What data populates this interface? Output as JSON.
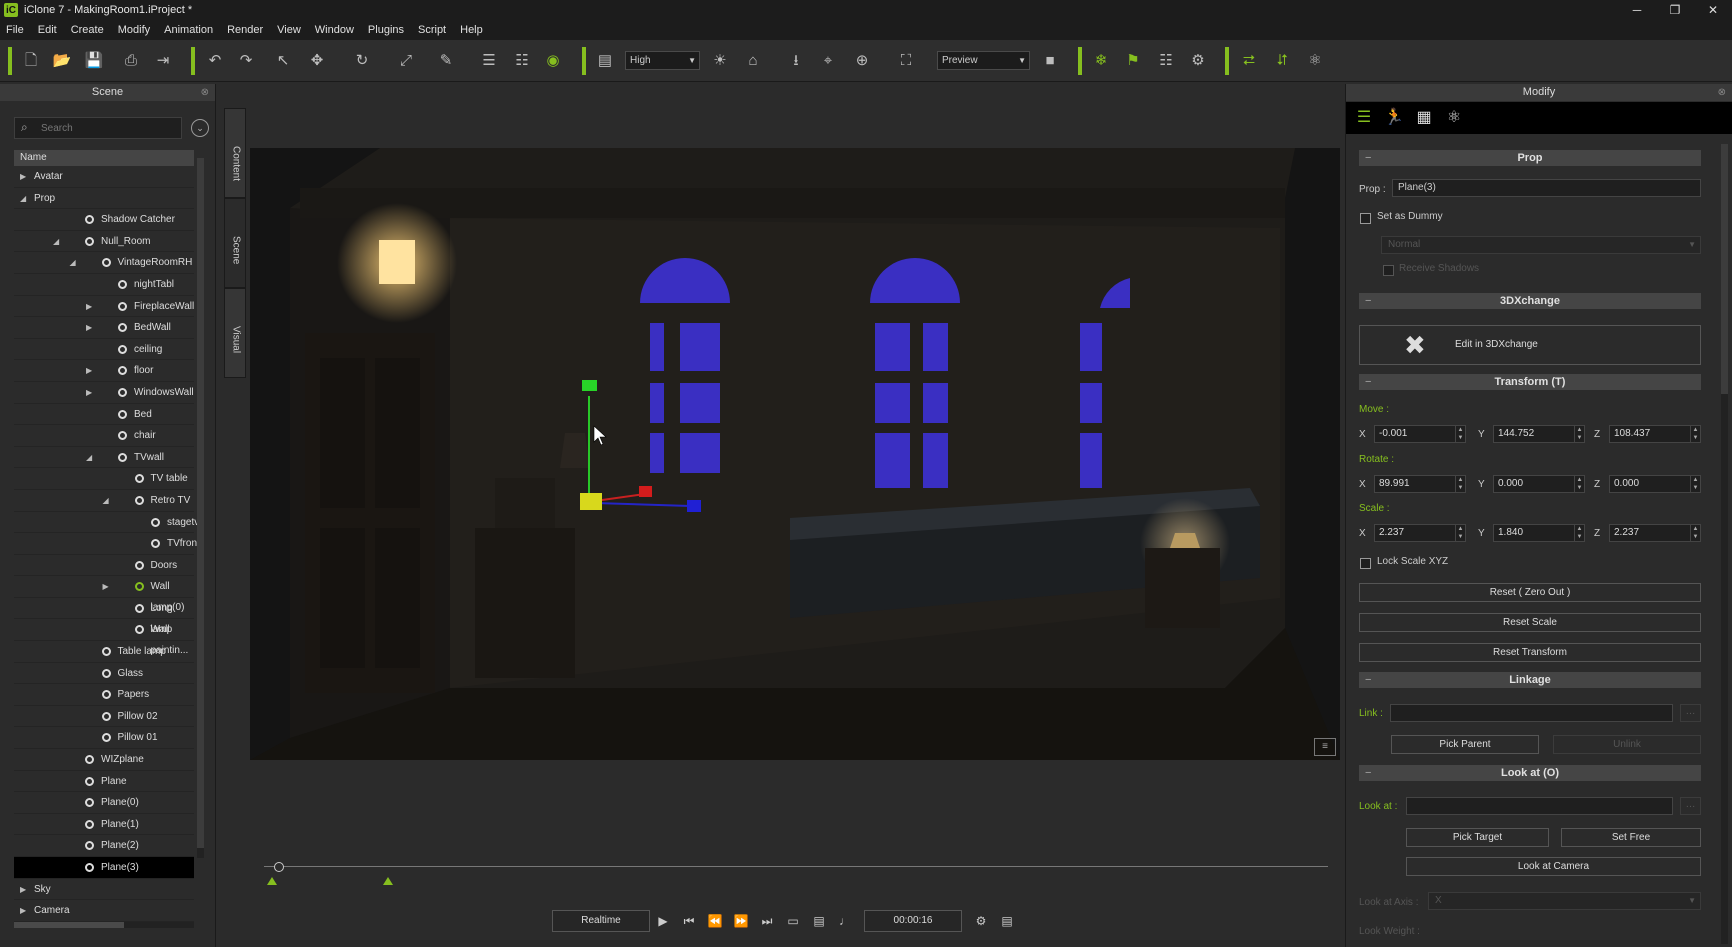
{
  "window": {
    "title": "iClone 7 - MakingRoom1.iProject *",
    "logo": "iC",
    "controls": [
      "minimize-icon",
      "restore-icon",
      "close-icon"
    ]
  },
  "menu": [
    "File",
    "Edit",
    "Create",
    "Modify",
    "Animation",
    "Render",
    "View",
    "Window",
    "Plugins",
    "Script",
    "Help"
  ],
  "toolbar": {
    "quality_value": "High",
    "render_mode_value": "Preview",
    "accent": "#86bf1f"
  },
  "scene_panel": {
    "title": "Scene",
    "search_placeholder": "Search",
    "column_name": "Name",
    "items": [
      {
        "label": "Avatar",
        "depth": 0,
        "expand": "collapsed",
        "icon": false
      },
      {
        "label": "Prop",
        "depth": 0,
        "expand": "expanded",
        "icon": false
      },
      {
        "label": "Shadow Catcher",
        "depth": 2,
        "expand": "none",
        "icon": true
      },
      {
        "label": "Null_Room",
        "depth": 2,
        "expand": "expanded",
        "icon": true
      },
      {
        "label": "VintageRoomRH",
        "depth": 3,
        "expand": "expanded",
        "icon": true
      },
      {
        "label": "nightTabl",
        "depth": 4,
        "expand": "none",
        "icon": true
      },
      {
        "label": "FireplaceWall",
        "depth": 4,
        "expand": "collapsed",
        "icon": true
      },
      {
        "label": "BedWall",
        "depth": 4,
        "expand": "collapsed",
        "icon": true
      },
      {
        "label": "ceiling",
        "depth": 4,
        "expand": "none",
        "icon": true
      },
      {
        "label": "floor",
        "depth": 4,
        "expand": "collapsed",
        "icon": true
      },
      {
        "label": "WindowsWall",
        "depth": 4,
        "expand": "collapsed",
        "icon": true
      },
      {
        "label": "Bed",
        "depth": 4,
        "expand": "none",
        "icon": true
      },
      {
        "label": "chair",
        "depth": 4,
        "expand": "none",
        "icon": true
      },
      {
        "label": "TVwall",
        "depth": 4,
        "expand": "expanded",
        "icon": true
      },
      {
        "label": "TV table",
        "depth": 5,
        "expand": "none",
        "icon": true
      },
      {
        "label": "Retro TV",
        "depth": 5,
        "expand": "expanded",
        "icon": true
      },
      {
        "label": "stagetv",
        "depth": 6,
        "expand": "none",
        "icon": true
      },
      {
        "label": "TVfront",
        "depth": 6,
        "expand": "none",
        "icon": true
      },
      {
        "label": "Doors",
        "depth": 5,
        "expand": "none",
        "icon": true
      },
      {
        "label": "Wall lamp(0)",
        "depth": 5,
        "expand": "collapsed",
        "icon": true,
        "green": true
      },
      {
        "label": "Long lamp",
        "depth": 5,
        "expand": "none",
        "icon": true
      },
      {
        "label": "Wall paintin...",
        "depth": 5,
        "expand": "none",
        "icon": true
      },
      {
        "label": "Table lamp",
        "depth": 3,
        "expand": "none",
        "icon": true
      },
      {
        "label": "Glass",
        "depth": 3,
        "expand": "none",
        "icon": true
      },
      {
        "label": "Papers",
        "depth": 3,
        "expand": "none",
        "icon": true
      },
      {
        "label": "Pillow 02",
        "depth": 3,
        "expand": "none",
        "icon": true
      },
      {
        "label": "Pillow 01",
        "depth": 3,
        "expand": "none",
        "icon": true
      },
      {
        "label": "WIZplane",
        "depth": 2,
        "expand": "none",
        "icon": true
      },
      {
        "label": "Plane",
        "depth": 2,
        "expand": "none",
        "icon": true
      },
      {
        "label": "Plane(0)",
        "depth": 2,
        "expand": "none",
        "icon": true
      },
      {
        "label": "Plane(1)",
        "depth": 2,
        "expand": "none",
        "icon": true
      },
      {
        "label": "Plane(2)",
        "depth": 2,
        "expand": "none",
        "icon": true
      },
      {
        "label": "Plane(3)",
        "depth": 2,
        "expand": "none",
        "icon": true,
        "selected": true
      },
      {
        "label": "Sky",
        "depth": 0,
        "expand": "collapsed",
        "icon": false
      },
      {
        "label": "Camera",
        "depth": 0,
        "expand": "collapsed",
        "icon": false
      }
    ]
  },
  "side_tabs": [
    "Content",
    "Scene",
    "Visual"
  ],
  "playback": {
    "realtime_label": "Realtime",
    "time_value": "00:00:16"
  },
  "modify_panel": {
    "title": "Modify",
    "prop_section": {
      "header": "Prop",
      "prop_label": "Prop :",
      "prop_value": "Plane(3)",
      "dummy_label": "Set as Dummy",
      "normal_value": "Normal",
      "receive_shadows_label": "Receive Shadows"
    },
    "xchange_section": {
      "header": "3DXchange",
      "edit_label": "Edit in 3DXchange"
    },
    "transform_section": {
      "header": "Transform  (T)",
      "move_label": "Move :",
      "rotate_label": "Rotate :",
      "scale_label": "Scale :",
      "move": {
        "x": "-0.001",
        "y": "144.752",
        "z": "108.437"
      },
      "rotate": {
        "x": "89.991",
        "y": "0.000",
        "z": "0.000"
      },
      "scale": {
        "x": "2.237",
        "y": "1.840",
        "z": "2.237"
      },
      "lock_scale_label": "Lock Scale XYZ",
      "reset_zero_label": "Reset ( Zero Out )",
      "reset_scale_label": "Reset Scale",
      "reset_transform_label": "Reset Transform"
    },
    "linkage_section": {
      "header": "Linkage",
      "link_label": "Link :",
      "pick_parent_label": "Pick Parent",
      "unlink_label": "Unlink"
    },
    "lookat_section": {
      "header": "Look at  (O)",
      "lookat_label": "Look at :",
      "pick_target_label": "Pick Target",
      "set_free_label": "Set Free",
      "look_at_camera_label": "Look at Camera",
      "look_at_axis_label": "Look at Axis :",
      "axis_value": "X",
      "look_weight_label": "Look Weight :"
    },
    "axis_letters": {
      "x": "X",
      "y": "Y",
      "z": "Z"
    }
  }
}
